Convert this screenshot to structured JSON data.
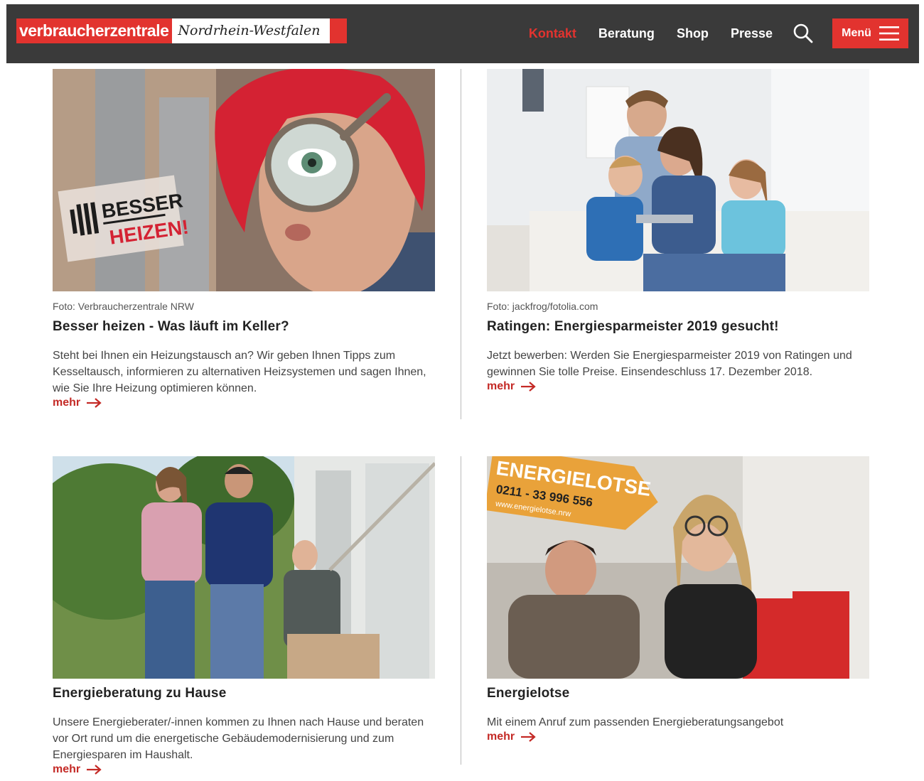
{
  "header": {
    "logo_main": "verbraucherzentrale",
    "logo_region": "Nordrhein-Westfalen",
    "nav": [
      "Kontakt",
      "Beratung",
      "Shop",
      "Presse"
    ],
    "menu_label": "Menü",
    "accent": "#e2332f",
    "bar_color": "#3a3a3a"
  },
  "cards": [
    {
      "credit": "Foto: Verbraucherzentrale NRW",
      "title": "Besser heizen - Was läuft im Keller?",
      "text": "Steht bei Ihnen ein Heizungstausch an? Wir geben Ihnen Tipps zum Kesseltausch, informieren zu alternativen Heizsystemen und sagen Ihnen, wie Sie Ihre Heizung optimieren können.",
      "more": "mehr",
      "image_badge": [
        "BESSER",
        "HEIZEN!"
      ]
    },
    {
      "credit": "Foto: jackfrog/fotolia.com",
      "title": "Ratingen: Energiesparmeister 2019 gesucht!",
      "text": "Jetzt bewerben: Werden Sie Energiesparmeister 2019 von Ratingen und gewinnen Sie tolle Preise. Einsendeschluss 17. Dezember 2018.",
      "more": "mehr"
    },
    {
      "title": "Energieberatung zu Hause",
      "text": "Unsere Energieberater/-innen kommen zu Ihnen nach Hause und beraten vor Ort rund um die energetische Gebäudemodernisierung und zum Energiesparen im Haushalt.",
      "more": "mehr"
    },
    {
      "title": "Energielotse",
      "text": "Mit einem Anruf zum passenden Energieberatungsangebot",
      "more": "mehr",
      "image_sign": [
        "ENERGIELOTSE",
        "0211 - 33 996 556",
        "www.energielotse.nrw"
      ]
    }
  ]
}
